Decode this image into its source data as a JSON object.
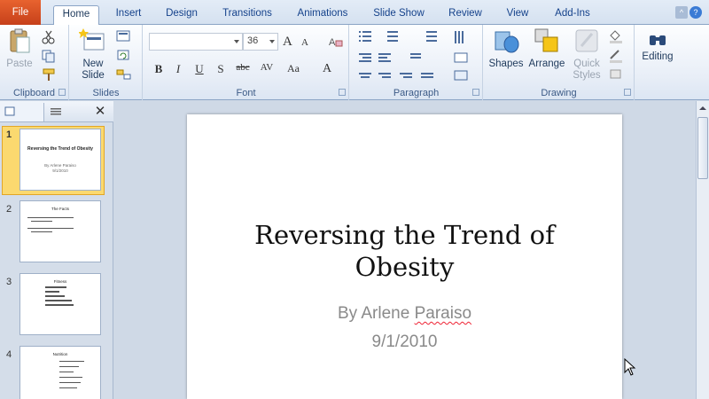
{
  "tabs": {
    "file": "File",
    "home": "Home",
    "insert": "Insert",
    "design": "Design",
    "transitions": "Transitions",
    "animations": "Animations",
    "slideshow": "Slide Show",
    "review": "Review",
    "view": "View",
    "addins": "Add-Ins"
  },
  "ribbon": {
    "clipboard": {
      "label": "Clipboard",
      "paste": "Paste"
    },
    "slides": {
      "label": "Slides",
      "new_slide_1": "New",
      "new_slide_2": "Slide"
    },
    "font": {
      "label": "Font",
      "font_name": "",
      "font_size": "36",
      "grow": "A",
      "shrink": "A",
      "bold": "B",
      "italic": "I",
      "underline": "U",
      "strike": "S",
      "abc": "abc",
      "spacing": "AV",
      "case": "Aa",
      "color": "A"
    },
    "paragraph": {
      "label": "Paragraph"
    },
    "drawing": {
      "label": "Drawing",
      "shapes": "Shapes",
      "arrange": "Arrange",
      "quick_styles_1": "Quick",
      "quick_styles_2": "Styles"
    },
    "editing": {
      "label": "Editing"
    }
  },
  "slides_panel": {
    "thumbs": [
      {
        "num": "1",
        "title": "Reversing the Trend of Obesity",
        "sub1": "By Arlene Paraiso",
        "sub2": "9/1/2010"
      },
      {
        "num": "2",
        "title": "The Facts"
      },
      {
        "num": "3",
        "title": "Fitness"
      },
      {
        "num": "4",
        "title": "Nutrition"
      }
    ]
  },
  "slide": {
    "title_line1": "Reversing the Trend of",
    "title_line2": "Obesity",
    "author_prefix": "By Arlene ",
    "author_name": "Paraiso",
    "date": "9/1/2010"
  },
  "colors": {
    "file_tab": "#d04a1f",
    "selection": "#fbd96f",
    "ribbon_text": "#1e395b"
  }
}
